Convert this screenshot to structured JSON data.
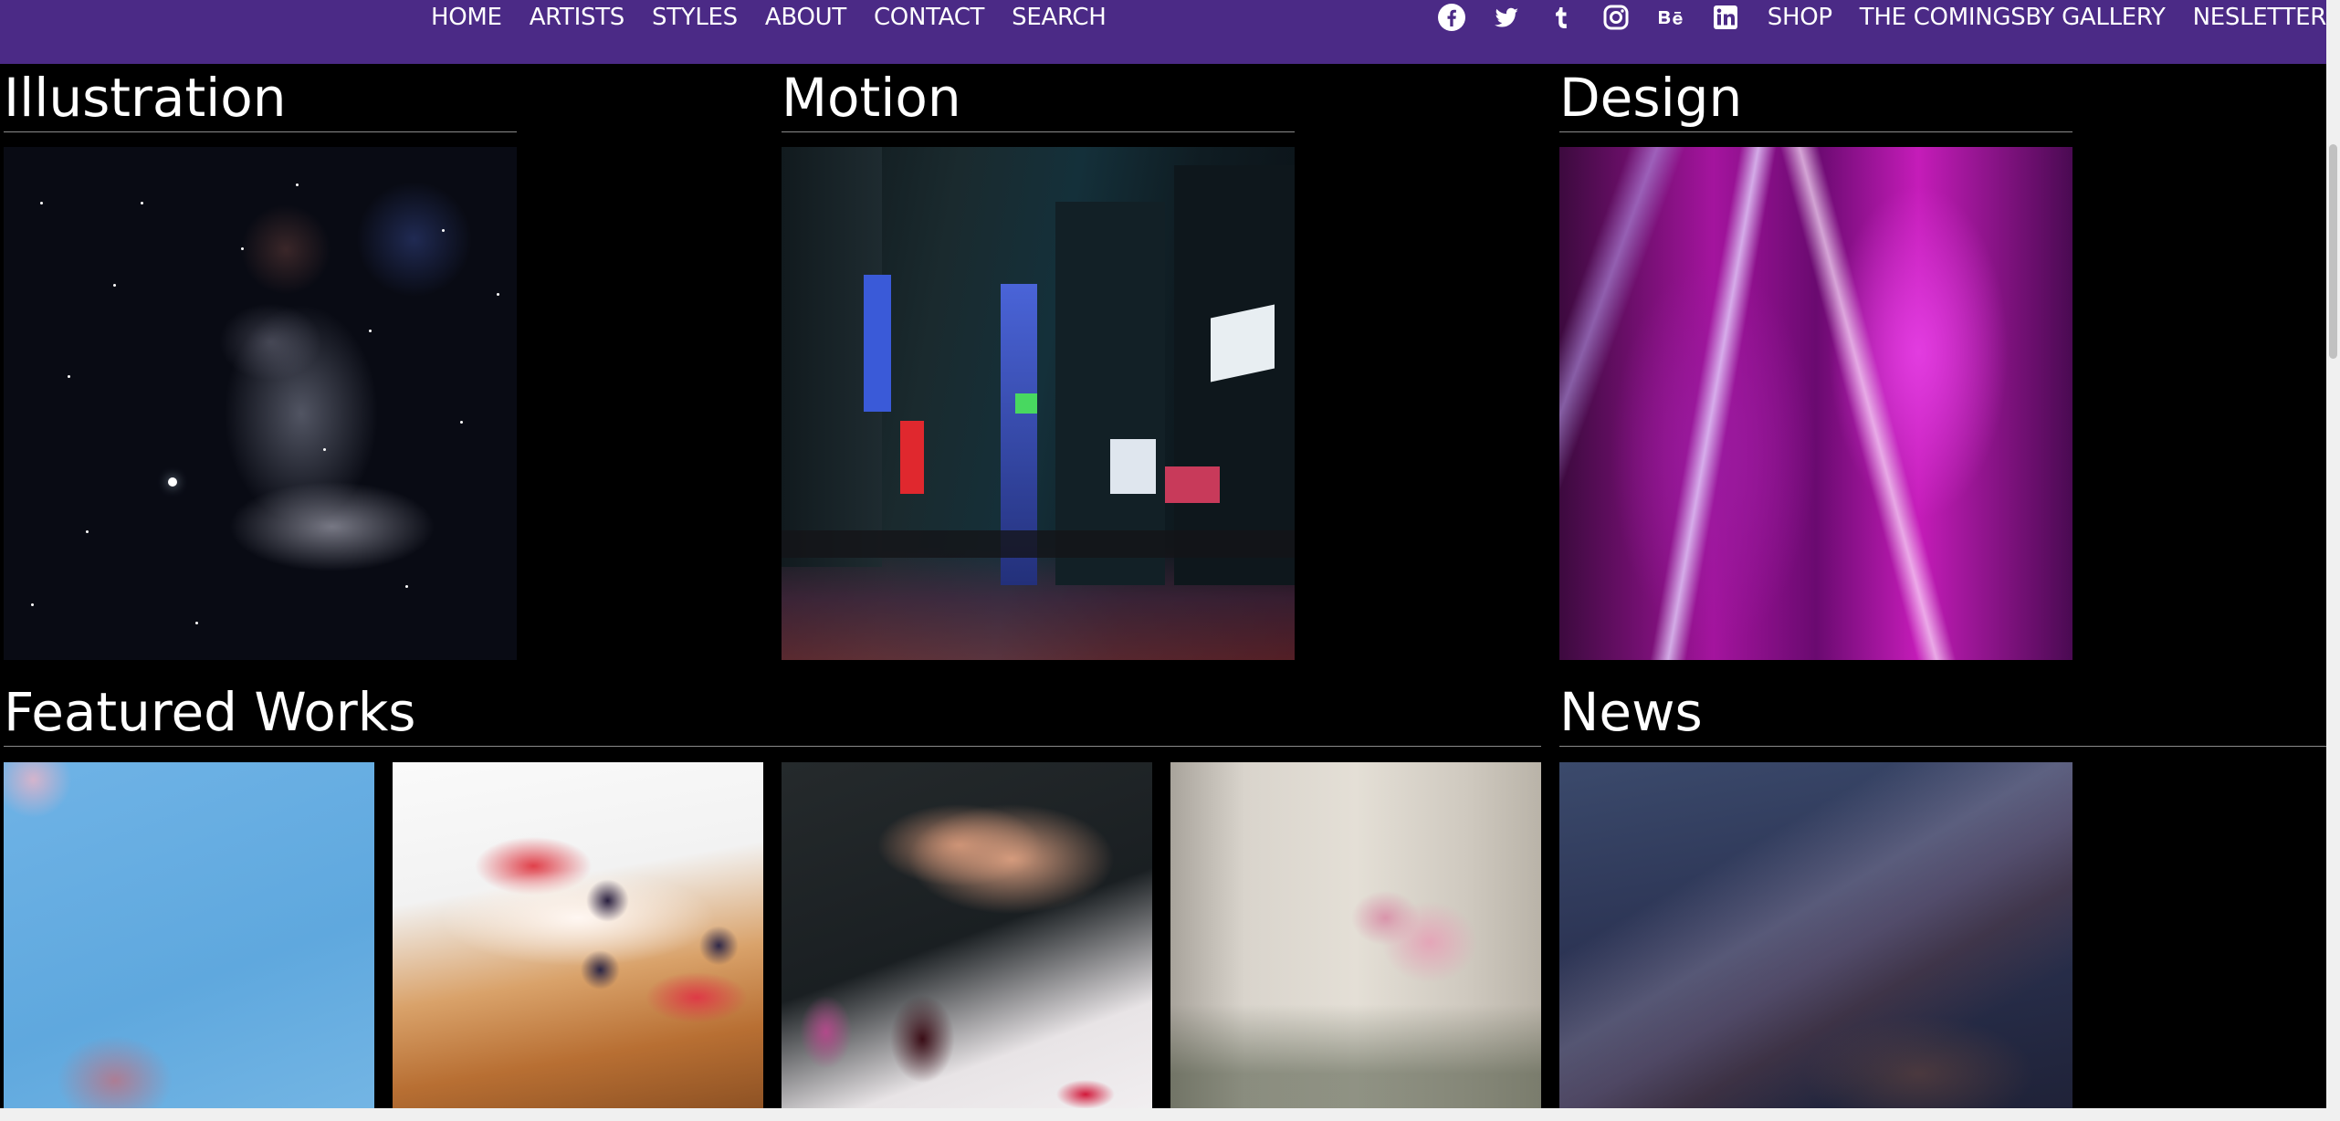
{
  "nav": {
    "left_links": [
      "HOME",
      "ARTISTS",
      "STYLES",
      "ABOUT",
      "CONTACT",
      "SEARCH"
    ],
    "social_icons": [
      "facebook-icon",
      "twitter-icon",
      "tumblr-icon",
      "instagram-icon",
      "behance-icon",
      "linkedin-icon"
    ],
    "right_links": [
      "SHOP",
      "THE COMINGSBY GALLERY",
      "NESLETTER"
    ]
  },
  "sections": {
    "illustration": {
      "title": "Illustration"
    },
    "motion": {
      "title": "Motion"
    },
    "design": {
      "title": "Design"
    },
    "featured": {
      "title": "Featured Works"
    },
    "news": {
      "title": "News"
    }
  },
  "colors": {
    "topbar": "#4b2a86",
    "background": "#000000",
    "heading_rule": "#8a8a8a"
  }
}
